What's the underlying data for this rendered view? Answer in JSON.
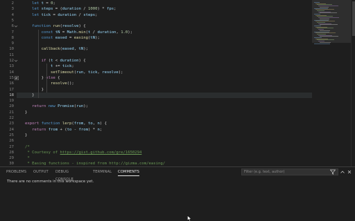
{
  "editor": {
    "lines": [
      {
        "n": "2",
        "tokens": [
          [
            "   ",
            "op"
          ],
          [
            "let ",
            "kw"
          ],
          [
            "t",
            "var"
          ],
          [
            " = ",
            "op"
          ],
          [
            "0",
            "num"
          ],
          [
            ";",
            "op"
          ]
        ]
      },
      {
        "n": "3",
        "tokens": [
          [
            "   ",
            "op"
          ],
          [
            "let ",
            "kw"
          ],
          [
            "steps",
            "var"
          ],
          [
            " = (",
            "op"
          ],
          [
            "duration",
            "var"
          ],
          [
            " / ",
            "op"
          ],
          [
            "1000",
            "num"
          ],
          [
            ") * ",
            "op"
          ],
          [
            "fps",
            "var"
          ],
          [
            ";",
            "op"
          ]
        ]
      },
      {
        "n": "4",
        "tokens": [
          [
            "   ",
            "op"
          ],
          [
            "let ",
            "kw"
          ],
          [
            "tick",
            "var"
          ],
          [
            " = ",
            "op"
          ],
          [
            "duration",
            "var"
          ],
          [
            " / ",
            "op"
          ],
          [
            "steps",
            "var"
          ],
          [
            ";",
            "op"
          ]
        ]
      },
      {
        "n": "5",
        "tokens": []
      },
      {
        "n": "6",
        "tokens": [
          [
            "   ",
            "op"
          ],
          [
            "function ",
            "kw"
          ],
          [
            "run",
            "fn"
          ],
          [
            "(",
            "op"
          ],
          [
            "resolve",
            "var"
          ],
          [
            ") {",
            "op"
          ]
        ]
      },
      {
        "n": "7",
        "tokens": [
          [
            "       ",
            "op"
          ],
          [
            "const ",
            "kw"
          ],
          [
            "tN",
            "var"
          ],
          [
            " = ",
            "op"
          ],
          [
            "Math",
            "var"
          ],
          [
            ".",
            "op"
          ],
          [
            "min",
            "fn"
          ],
          [
            "(",
            "op"
          ],
          [
            "t",
            "var"
          ],
          [
            " / ",
            "op"
          ],
          [
            "duration",
            "var"
          ],
          [
            ", ",
            "op"
          ],
          [
            "1.0",
            "num"
          ],
          [
            ");",
            "op"
          ]
        ]
      },
      {
        "n": "8",
        "tokens": [
          [
            "       ",
            "op"
          ],
          [
            "const ",
            "kw"
          ],
          [
            "eased",
            "var"
          ],
          [
            " = ",
            "op"
          ],
          [
            "easing",
            "fn"
          ],
          [
            "(",
            "op"
          ],
          [
            "tN",
            "var"
          ],
          [
            ");",
            "op"
          ]
        ]
      },
      {
        "n": "9",
        "tokens": []
      },
      {
        "n": "10",
        "tokens": [
          [
            "       ",
            "op"
          ],
          [
            "callback",
            "fn"
          ],
          [
            "(",
            "op"
          ],
          [
            "eased",
            "var"
          ],
          [
            ", ",
            "op"
          ],
          [
            "tN",
            "var"
          ],
          [
            ");",
            "op"
          ]
        ]
      },
      {
        "n": "11",
        "tokens": []
      },
      {
        "n": "12",
        "tokens": [
          [
            "       ",
            "op"
          ],
          [
            "if ",
            "ct"
          ],
          [
            "(",
            "op"
          ],
          [
            "t",
            "var"
          ],
          [
            " < ",
            "op"
          ],
          [
            "duration",
            "var"
          ],
          [
            ") {",
            "op"
          ]
        ]
      },
      {
        "n": "13",
        "tokens": [
          [
            "           ",
            "op"
          ],
          [
            "t",
            "var"
          ],
          [
            " += ",
            "op"
          ],
          [
            "tick",
            "var"
          ],
          [
            ";",
            "op"
          ]
        ]
      },
      {
        "n": "14",
        "tokens": [
          [
            "           ",
            "op"
          ],
          [
            "setTimeout",
            "fn"
          ],
          [
            "(",
            "op"
          ],
          [
            "run",
            "var"
          ],
          [
            ", ",
            "op"
          ],
          [
            "tick",
            "var"
          ],
          [
            ", ",
            "op"
          ],
          [
            "resolve",
            "var"
          ],
          [
            ");",
            "op"
          ]
        ]
      },
      {
        "n": "15",
        "tokens": [
          [
            "       ",
            "op"
          ],
          [
            "} ",
            "op"
          ],
          [
            "else",
            "ct"
          ],
          [
            " {",
            "op"
          ]
        ]
      },
      {
        "n": "16",
        "tokens": [
          [
            "           ",
            "op"
          ],
          [
            "resolve",
            "fn"
          ],
          [
            "();",
            "op"
          ]
        ]
      },
      {
        "n": "17",
        "tokens": [
          [
            "       ",
            "op"
          ],
          [
            "}",
            "op"
          ]
        ]
      },
      {
        "n": "18",
        "tokens": [
          [
            "   ",
            "op"
          ],
          [
            "}",
            "op"
          ]
        ]
      },
      {
        "n": "19",
        "tokens": []
      },
      {
        "n": "20",
        "tokens": [
          [
            "   ",
            "op"
          ],
          [
            "return ",
            "ct"
          ],
          [
            "new ",
            "kw"
          ],
          [
            "Promise",
            "var"
          ],
          [
            "(",
            "op"
          ],
          [
            "run",
            "var"
          ],
          [
            ");",
            "op"
          ]
        ]
      },
      {
        "n": "21",
        "tokens": [
          [
            "}",
            "op"
          ]
        ]
      },
      {
        "n": "22",
        "tokens": []
      },
      {
        "n": "23",
        "tokens": [
          [
            "export ",
            "ct"
          ],
          [
            "function ",
            "kw"
          ],
          [
            "lerp",
            "fn"
          ],
          [
            "(",
            "op"
          ],
          [
            "from",
            "var"
          ],
          [
            ", ",
            "op"
          ],
          [
            "to",
            "var"
          ],
          [
            ", ",
            "op"
          ],
          [
            "n",
            "var"
          ],
          [
            ") {",
            "op"
          ]
        ]
      },
      {
        "n": "24",
        "tokens": [
          [
            "   ",
            "op"
          ],
          [
            "return ",
            "ct"
          ],
          [
            "from",
            "var"
          ],
          [
            " + (",
            "op"
          ],
          [
            "to",
            "var"
          ],
          [
            " - ",
            "op"
          ],
          [
            "from",
            "var"
          ],
          [
            ") * ",
            "op"
          ],
          [
            "n",
            "var"
          ],
          [
            ";",
            "op"
          ]
        ]
      },
      {
        "n": "25",
        "tokens": [
          [
            "}",
            "op"
          ]
        ]
      },
      {
        "n": "26",
        "tokens": []
      },
      {
        "n": "27",
        "tokens": [
          [
            "/*",
            "cm"
          ]
        ]
      },
      {
        "n": "28",
        "tokens": [
          [
            " * Courtesy of ",
            "cm"
          ],
          [
            "https://gist.github.com/gre/1650294",
            "link"
          ]
        ]
      },
      {
        "n": "29",
        "tokens": [
          [
            " *",
            "cm"
          ]
        ]
      },
      {
        "n": "30",
        "tokens": [
          [
            " * Easing functions - inspired from http://gizma.com/easing/",
            "cm"
          ]
        ]
      }
    ],
    "current_line": "18"
  },
  "panel": {
    "tabs": [
      {
        "label": "PROBLEMS",
        "active": false
      },
      {
        "label": "OUTPUT",
        "active": false
      },
      {
        "label": "DEBUG CONSOLE",
        "active": false
      },
      {
        "label": "TERMINAL",
        "active": false
      },
      {
        "label": "COMMENTS",
        "active": true
      }
    ],
    "filter_placeholder": "Filter (e.g. text, author)",
    "empty_message": "There are no comments in this workspace yet."
  },
  "colors": {
    "editor_bg": "#1e1e1e",
    "keyword": "#569cd6",
    "control": "#c586c0",
    "function": "#dcdcaa",
    "variable": "#9cdcfe",
    "number": "#b5cea8",
    "comment": "#6a9955"
  },
  "icons": {
    "filter": "filter-icon",
    "maximize": "chevron-up-icon",
    "close": "close-icon",
    "fold": "fold-arrow-icon",
    "pointer": "mouse-pointer-icon"
  }
}
